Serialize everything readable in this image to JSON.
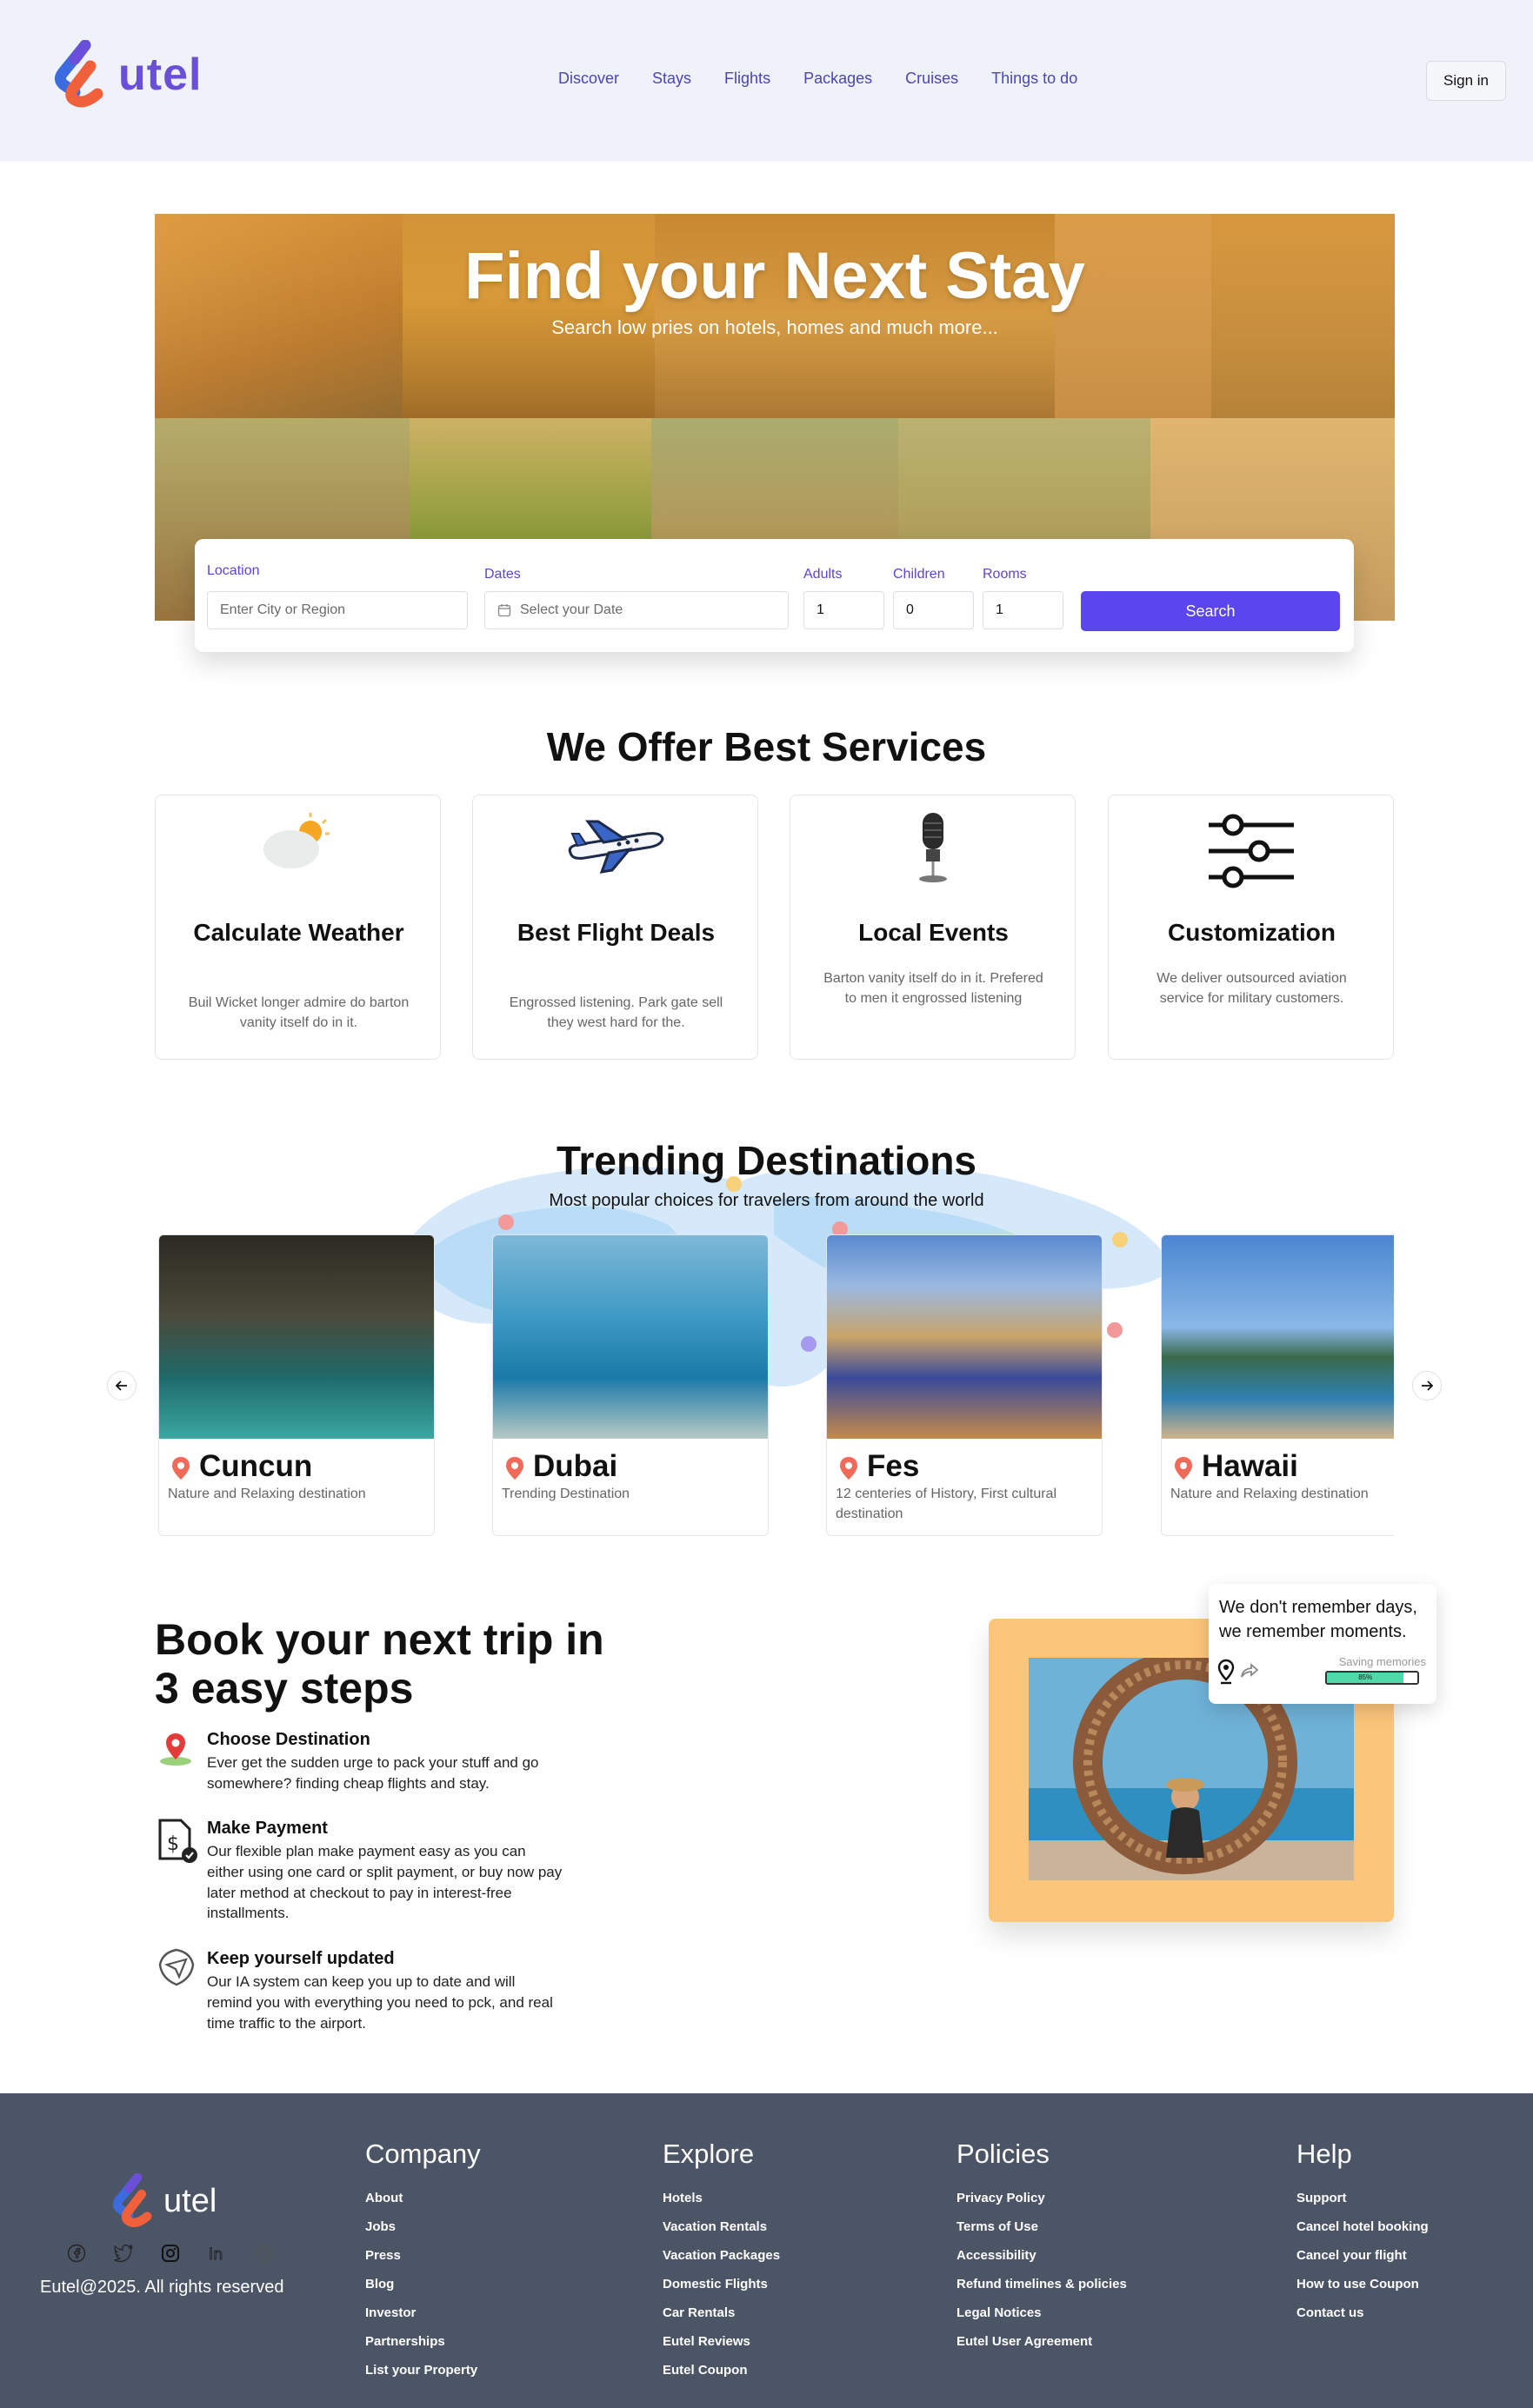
{
  "brand": {
    "logo_text": "utel",
    "accent": "#6a4fd8",
    "primary_button": "#5a45ee"
  },
  "nav": {
    "items": [
      "Discover",
      "Stays",
      "Flights",
      "Packages",
      "Cruises",
      "Things to do"
    ],
    "signin": "Sign in"
  },
  "hero": {
    "title": "Find your Next Stay",
    "subtitle": "Search low pries on hotels, homes and much more..."
  },
  "search": {
    "location_label": "Location",
    "location_placeholder": "Enter City or Region",
    "dates_label": "Dates",
    "dates_placeholder": "Select your Date",
    "adults_label": "Adults",
    "adults_value": "1",
    "children_label": "Children",
    "children_value": "0",
    "rooms_label": "Rooms",
    "rooms_value": "1",
    "button": "Search"
  },
  "services": {
    "title": "We Offer Best Services",
    "cards": [
      {
        "icon": "weather-icon",
        "title": "Calculate Weather",
        "desc": "Buil Wicket longer admire do barton vanity itself do in it."
      },
      {
        "icon": "airplane-icon",
        "title": "Best Flight Deals",
        "desc": "Engrossed listening. Park gate sell they west hard for the."
      },
      {
        "icon": "microphone-icon",
        "title": "Local Events",
        "desc": "Barton vanity itself do in it. Prefered to men it engrossed listening"
      },
      {
        "icon": "sliders-icon",
        "title": "Customization",
        "desc": "We deliver outsourced aviation service for military customers."
      }
    ]
  },
  "trending": {
    "title": "Trending Destinations",
    "subtitle": "Most popular choices for travelers from around the world",
    "destinations": [
      {
        "name": "Cuncun",
        "desc": "Nature and Relaxing destination"
      },
      {
        "name": "Dubai",
        "desc": "Trending Destination"
      },
      {
        "name": "Fes",
        "desc": "12 centeries of History, First cultural destination"
      },
      {
        "name": "Hawaii",
        "desc": "Nature and Relaxing destination"
      }
    ]
  },
  "steps": {
    "title": "Book your next trip in 3 easy steps",
    "items": [
      {
        "icon": "map-pin-icon",
        "title": "Choose Destination",
        "desc": "Ever get the sudden urge to pack your stuff and go somewhere? finding cheap flights and stay."
      },
      {
        "icon": "payment-document-icon",
        "title": "Make Payment",
        "desc": "Our flexible plan make payment easy as you can either using one card or split payment, or buy now pay later method at checkout to pay in interest-free installments."
      },
      {
        "icon": "airplane-badge-icon",
        "title": "Keep yourself updated",
        "desc": "Our IA system can keep you up to date and will remind you with everything you need to pck, and real time traffic to the airport."
      }
    ]
  },
  "memory_card": {
    "text": "We don't remember days, we remember moments.",
    "saving_label": "Saving memories",
    "progress_label": "85%",
    "progress": 0.85
  },
  "footer": {
    "logo_text": "utel",
    "copyright": "Eutel@2025. All rights reserved",
    "columns": [
      {
        "heading": "Company",
        "links": [
          "About",
          "Jobs",
          "Press",
          "Blog",
          "Investor",
          "Partnerships",
          "List your Property"
        ]
      },
      {
        "heading": "Explore",
        "links": [
          "Hotels",
          "Vacation Rentals",
          "Vacation Packages",
          "Domestic Flights",
          "Car Rentals",
          "Eutel Reviews",
          "Eutel Coupon"
        ]
      },
      {
        "heading": "Policies",
        "links": [
          "Privacy Policy",
          "Terms of Use",
          "Accessibility",
          "Refund timelines & policies",
          "Legal Notices",
          "Eutel User Agreement"
        ]
      },
      {
        "heading": "Help",
        "links": [
          "Support",
          "Cancel hotel booking",
          "Cancel your flight",
          "How to use Coupon",
          "Contact us"
        ]
      }
    ]
  }
}
